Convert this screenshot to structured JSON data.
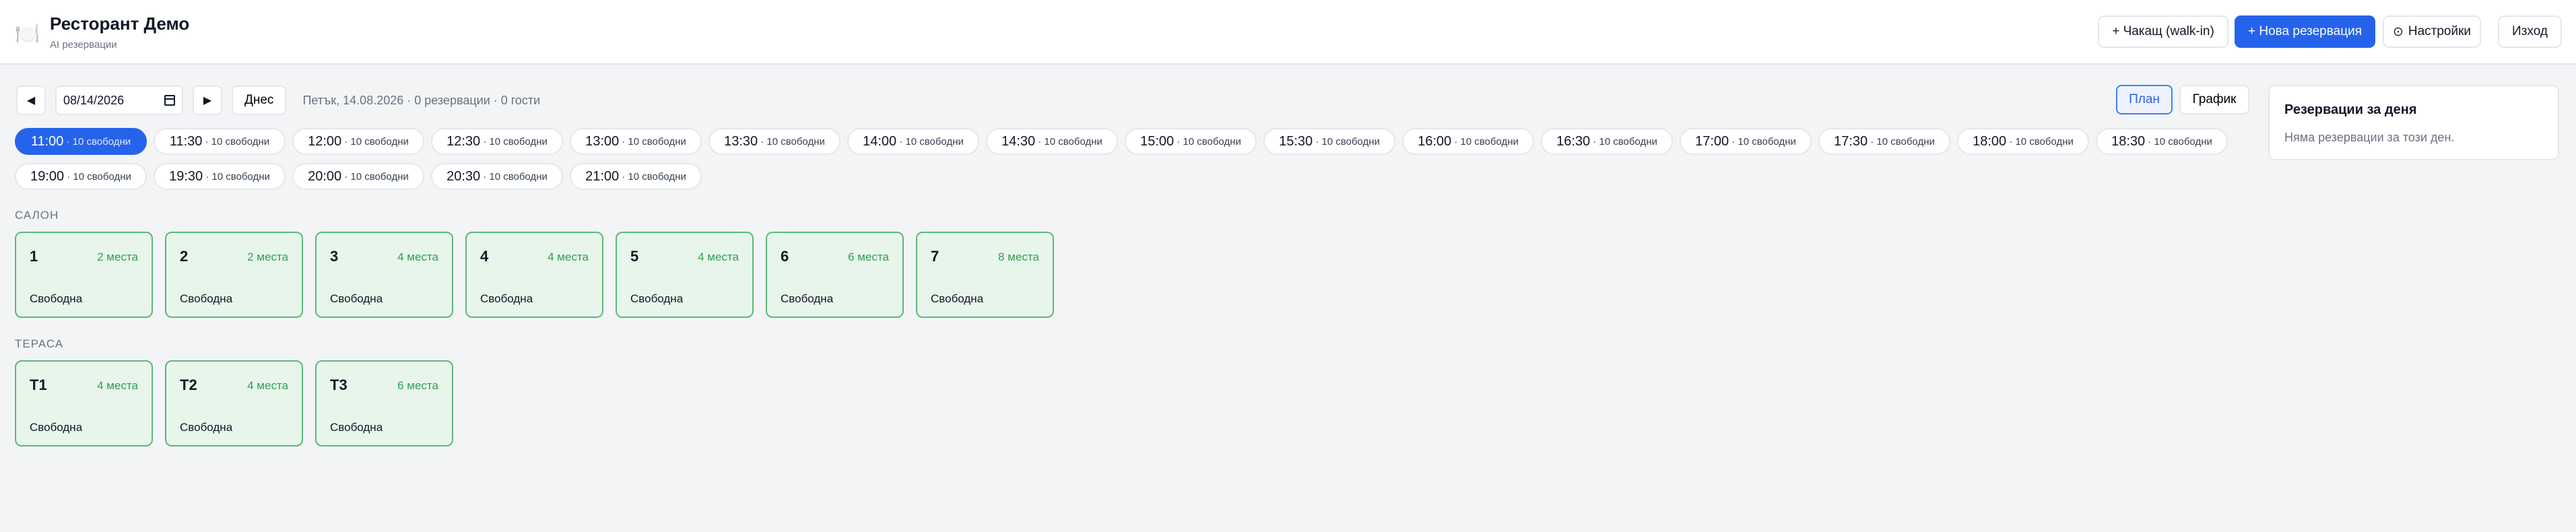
{
  "header": {
    "logo_emoji": "🍽️",
    "title": "Ресторант Демо",
    "subtitle": "AI резервации",
    "walkin_label": "+ Чакащ (walk-in)",
    "new_reservation_label": "+ Нова резервация",
    "settings_label": "Настройки",
    "logout_label": "Изход"
  },
  "toolbar": {
    "prev_symbol": "◀",
    "next_symbol": "▶",
    "date_value": "08/14/2026",
    "today_label": "Днес",
    "day_info": "Петък, 14.08.2026 · 0 резервации · 0 гости",
    "view_plan_label": "План",
    "view_schedule_label": "График"
  },
  "slots": [
    {
      "time": "11:00",
      "free": "· 10 свободни",
      "active": true
    },
    {
      "time": "11:30",
      "free": "· 10 свободни"
    },
    {
      "time": "12:00",
      "free": "· 10 свободни"
    },
    {
      "time": "12:30",
      "free": "· 10 свободни"
    },
    {
      "time": "13:00",
      "free": "· 10 свободни"
    },
    {
      "time": "13:30",
      "free": "· 10 свободни"
    },
    {
      "time": "14:00",
      "free": "· 10 свободни"
    },
    {
      "time": "14:30",
      "free": "· 10 свободни"
    },
    {
      "time": "15:00",
      "free": "· 10 свободни"
    },
    {
      "time": "15:30",
      "free": "· 10 свободни"
    },
    {
      "time": "16:00",
      "free": "· 10 свободни"
    },
    {
      "time": "16:30",
      "free": "· 10 свободни"
    },
    {
      "time": "17:00",
      "free": "· 10 свободни"
    },
    {
      "time": "17:30",
      "free": "· 10 свободни"
    },
    {
      "time": "18:00",
      "free": "· 10 свободни"
    },
    {
      "time": "18:30",
      "free": "· 10 свободни"
    },
    {
      "time": "19:00",
      "free": "· 10 свободни"
    },
    {
      "time": "19:30",
      "free": "· 10 свободни"
    },
    {
      "time": "20:00",
      "free": "· 10 свободни"
    },
    {
      "time": "20:30",
      "free": "· 10 свободни"
    },
    {
      "time": "21:00",
      "free": "· 10 свободни"
    }
  ],
  "areas": {
    "salon": {
      "label": "САЛОН",
      "tables": [
        {
          "name": "1",
          "seats": "2 места",
          "status": "Свободна"
        },
        {
          "name": "2",
          "seats": "2 места",
          "status": "Свободна"
        },
        {
          "name": "3",
          "seats": "4 места",
          "status": "Свободна"
        },
        {
          "name": "4",
          "seats": "4 места",
          "status": "Свободна"
        },
        {
          "name": "5",
          "seats": "4 места",
          "status": "Свободна"
        },
        {
          "name": "6",
          "seats": "6 места",
          "status": "Свободна"
        },
        {
          "name": "7",
          "seats": "8 места",
          "status": "Свободна"
        }
      ]
    },
    "terrace": {
      "label": "ТЕРАСА",
      "tables": [
        {
          "name": "Т1",
          "seats": "4 места",
          "status": "Свободна"
        },
        {
          "name": "Т2",
          "seats": "4 места",
          "status": "Свободна"
        },
        {
          "name": "Т3",
          "seats": "6 места",
          "status": "Свободна"
        }
      ]
    }
  },
  "side_panel": {
    "title": "Резервации за деня",
    "empty_text": "Няма резервации за този ден."
  },
  "colors": {
    "accent": "#2563eb",
    "table_free_bg": "#e7f5ea",
    "table_free_border": "#5cb87a",
    "seats_text": "#2f9e50"
  }
}
